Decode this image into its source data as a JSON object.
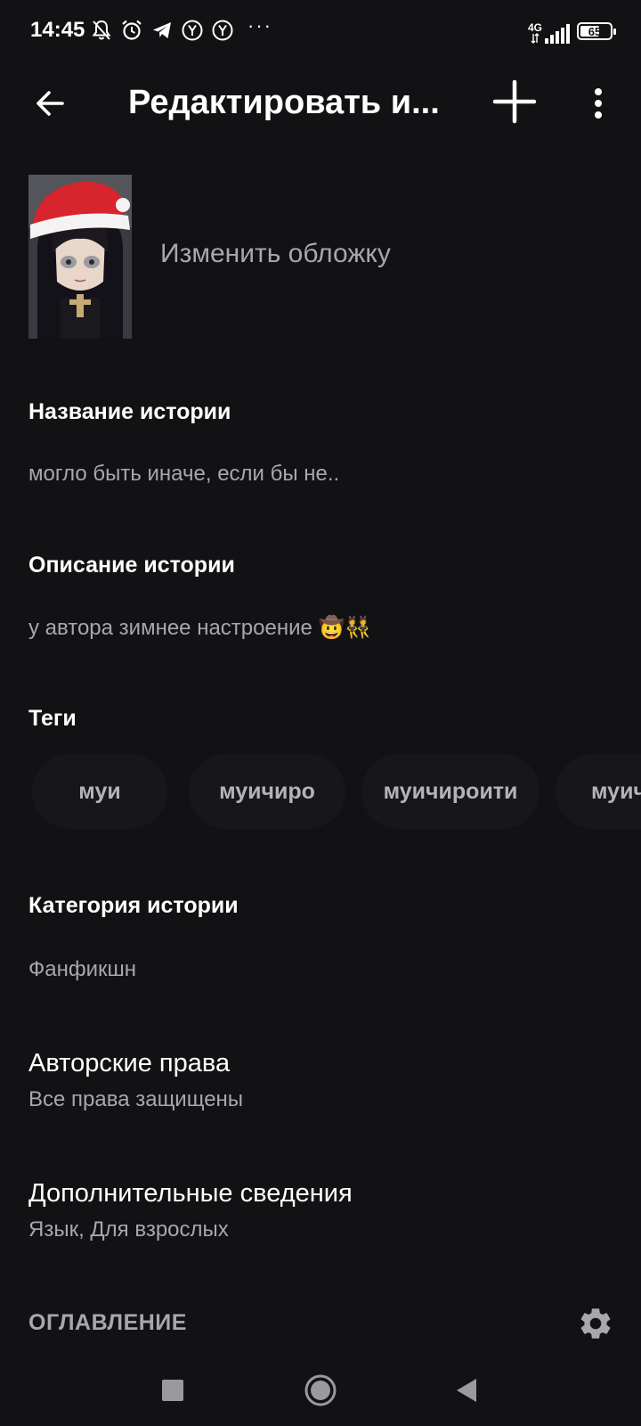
{
  "status_bar": {
    "time": "14:45",
    "network_type": "4G",
    "battery_level": "65",
    "battery_fraction": 0.65,
    "overflow_dots": "···",
    "icons": [
      "notifications-off-icon",
      "alarm-icon",
      "telegram-icon",
      "yandex-icon",
      "yandex-icon",
      "signal-icon",
      "battery-icon"
    ]
  },
  "app_bar": {
    "title": "Редактировать и...",
    "icons": [
      "back-arrow-icon",
      "plus-icon",
      "more-vert-icon"
    ]
  },
  "cover": {
    "change_label": "Изменить обложку"
  },
  "story": {
    "title_label": "Название истории",
    "title_value": "могло быть иначе, если бы не..",
    "description_label": "Описание истории",
    "description_value": "у автора зимнее настроение 🤠👯",
    "tags_label": "Теги",
    "tags": [
      "муи",
      "муичиро",
      "муичироити",
      "муичиро"
    ],
    "category_label": "Категория истории",
    "category_value": "Фанфикшн"
  },
  "menu": {
    "copyright_title": "Авторские права",
    "copyright_subtitle": "Все права защищены",
    "details_title": "Дополнительные сведения",
    "details_subtitle": "Язык, Для взрослых"
  },
  "toc": {
    "header": "ОГЛАВЛЕНИЕ"
  },
  "nav_bar": {
    "icons": [
      "recents-square-icon",
      "home-circle-icon",
      "back-triangle-icon"
    ]
  },
  "colors": {
    "background": "#121214",
    "primary_text": "#ffffff",
    "secondary_text": "#a8a8ac",
    "chip_background": "#17171a"
  }
}
